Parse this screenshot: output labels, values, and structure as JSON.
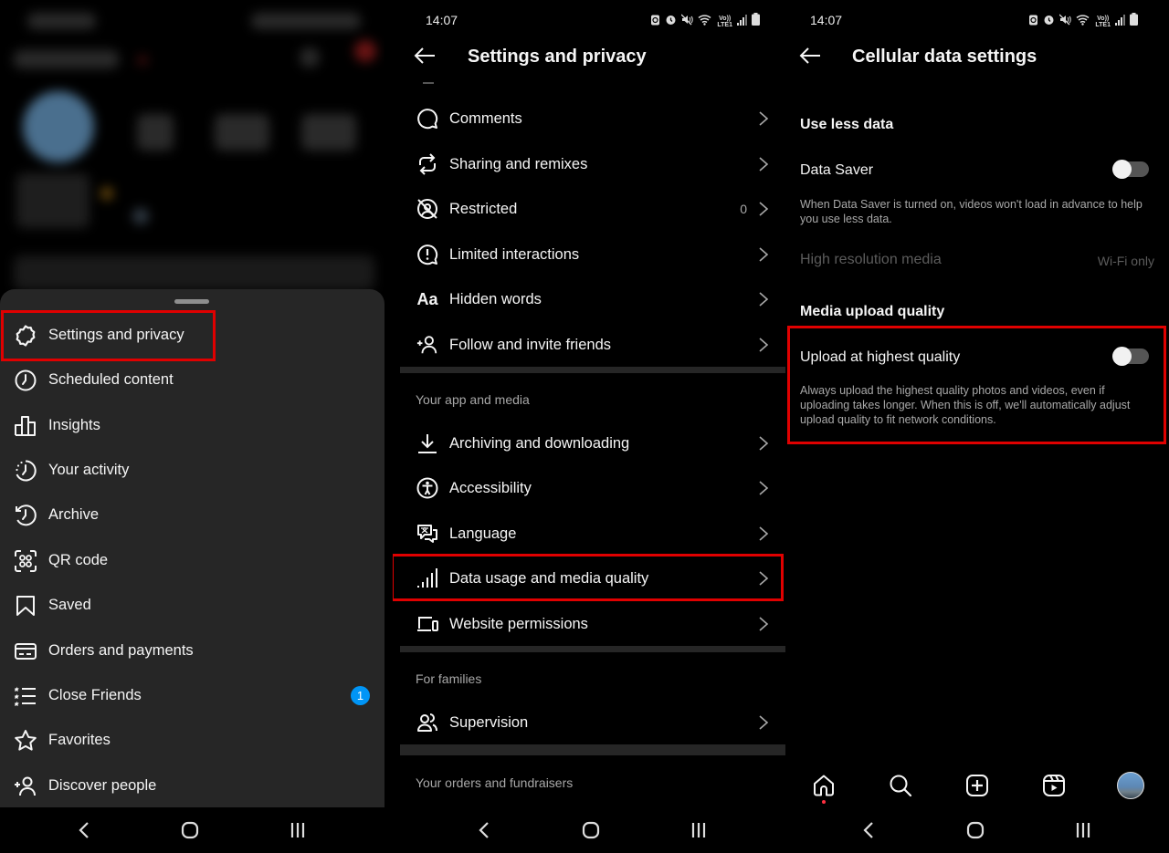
{
  "colors": {
    "background": "#000000",
    "sheet": "#262626",
    "highlight_box": "#e00000",
    "badge": "#0095f6",
    "secondary_text": "#a8a8a8",
    "notification_dot": "#ff3040"
  },
  "status_bar": {
    "time": "14:07",
    "icons": [
      "battery-saver-icon",
      "alarm-icon",
      "mute-icon",
      "wifi-icon",
      "volte-lte-icon",
      "signal-icon",
      "battery-icon"
    ],
    "volte_label_top": "Vo))",
    "volte_label_bottom": "LTE1"
  },
  "menu_sheet": {
    "items": [
      {
        "label": "Settings and privacy",
        "icon": "settings-icon",
        "highlighted": true
      },
      {
        "label": "Scheduled content",
        "icon": "clock-icon"
      },
      {
        "label": "Insights",
        "icon": "insights-icon"
      },
      {
        "label": "Your activity",
        "icon": "activity-icon"
      },
      {
        "label": "Archive",
        "icon": "archive-icon"
      },
      {
        "label": "QR code",
        "icon": "qr-code-icon"
      },
      {
        "label": "Saved",
        "icon": "bookmark-icon"
      },
      {
        "label": "Orders and payments",
        "icon": "card-icon"
      },
      {
        "label": "Close Friends",
        "icon": "close-friends-icon",
        "badge": "1"
      },
      {
        "label": "Favorites",
        "icon": "star-icon"
      },
      {
        "label": "Discover people",
        "icon": "add-person-icon"
      }
    ]
  },
  "settings_page": {
    "title": "Settings and privacy",
    "group1": [
      {
        "label": "Comments",
        "icon": "comment-icon"
      },
      {
        "label": "Sharing and remixes",
        "icon": "share-remix-icon"
      },
      {
        "label": "Restricted",
        "icon": "restricted-icon",
        "count": "0"
      },
      {
        "label": "Limited interactions",
        "icon": "limited-icon"
      },
      {
        "label": "Hidden words",
        "icon": "hidden-words-icon",
        "icon_text": "Aa"
      },
      {
        "label": "Follow and invite friends",
        "icon": "add-person-icon"
      }
    ],
    "section_app_media": "Your app and media",
    "group2": [
      {
        "label": "Archiving and downloading",
        "icon": "download-icon"
      },
      {
        "label": "Accessibility",
        "icon": "accessibility-icon"
      },
      {
        "label": "Language",
        "icon": "language-icon"
      },
      {
        "label": "Data usage and media quality",
        "icon": "signal-bars-icon",
        "highlighted": true
      },
      {
        "label": "Website permissions",
        "icon": "devices-icon"
      }
    ],
    "section_families": "For families",
    "group3": [
      {
        "label": "Supervision",
        "icon": "supervision-icon"
      }
    ],
    "section_orders": "Your orders and fundraisers"
  },
  "cellular_page": {
    "title": "Cellular data settings",
    "section_less_data": "Use less data",
    "data_saver": {
      "label": "Data Saver",
      "enabled": false,
      "description": "When Data Saver is turned on, videos won't load in advance to help you use less data."
    },
    "high_res": {
      "label": "High resolution media",
      "value": "Wi-Fi only",
      "disabled": true
    },
    "section_upload": "Media upload quality",
    "upload_highest": {
      "label": "Upload at highest quality",
      "enabled": false,
      "highlighted": true,
      "description": "Always upload the highest quality photos and videos, even if uploading takes longer. When this is off, we'll automatically adjust upload quality to fit network conditions."
    },
    "tab_bar": [
      "home-icon",
      "search-icon",
      "create-icon",
      "reels-icon",
      "profile-avatar"
    ]
  },
  "system_nav": [
    "back-button",
    "home-button",
    "recents-button"
  ]
}
